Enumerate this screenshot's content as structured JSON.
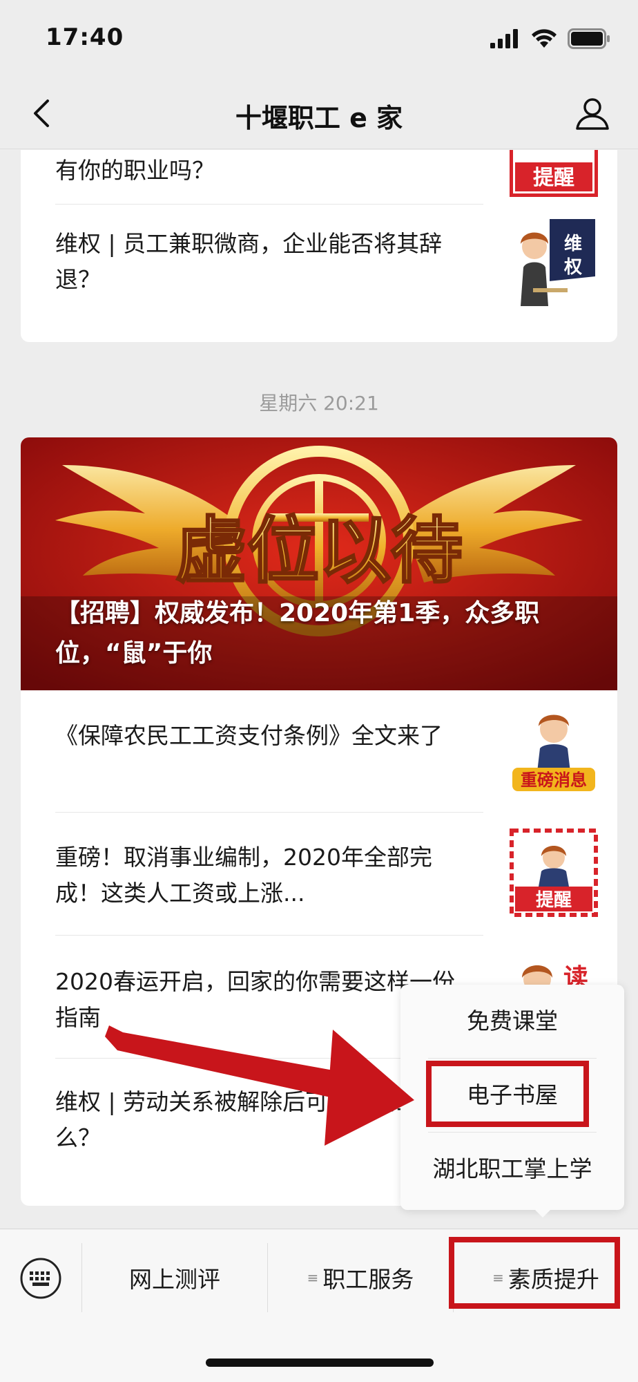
{
  "status_bar": {
    "time": "17:40"
  },
  "nav": {
    "title": "十堰职工 e 家"
  },
  "feed": {
    "group1": [
      {
        "title": "有你的职业吗？",
        "thumb": "提醒"
      },
      {
        "title": "维权 | 员工兼职微商，企业能否将其辞退？",
        "thumb": "维权"
      }
    ],
    "timestamp": "星期六 20:21",
    "cover": {
      "banner_text": "虚位以待",
      "title": "【招聘】权威发布！2020年第1季，众多职位，“鼠”于你"
    },
    "group2": [
      {
        "title": "《保障农民工工资支付条例》全文来了",
        "thumb": "重磅消息"
      },
      {
        "title": "重磅！取消事业编制，2020年全部完成！这类人工资或上涨...",
        "thumb": "提醒"
      },
      {
        "title": "2020春运开启，回家的你需要这样一份指南",
        "thumb": "读"
      },
      {
        "title": "维权 | 劳动关系被解除后可以申请工伤么？",
        "thumb": ""
      }
    ]
  },
  "popup_menu": {
    "items": [
      {
        "label": "免费课堂"
      },
      {
        "label": "电子书屋"
      },
      {
        "label": "湖北职工掌上学"
      }
    ]
  },
  "bottom_bar": {
    "tabs": [
      {
        "label": "网上测评",
        "has_menu": false
      },
      {
        "label": "职工服务",
        "has_menu": true
      },
      {
        "label": "素质提升",
        "has_menu": true
      }
    ],
    "menu_glyph": "≡"
  },
  "colors": {
    "annotation_red": "#c8151b",
    "thumb_red": "#d8232a"
  }
}
